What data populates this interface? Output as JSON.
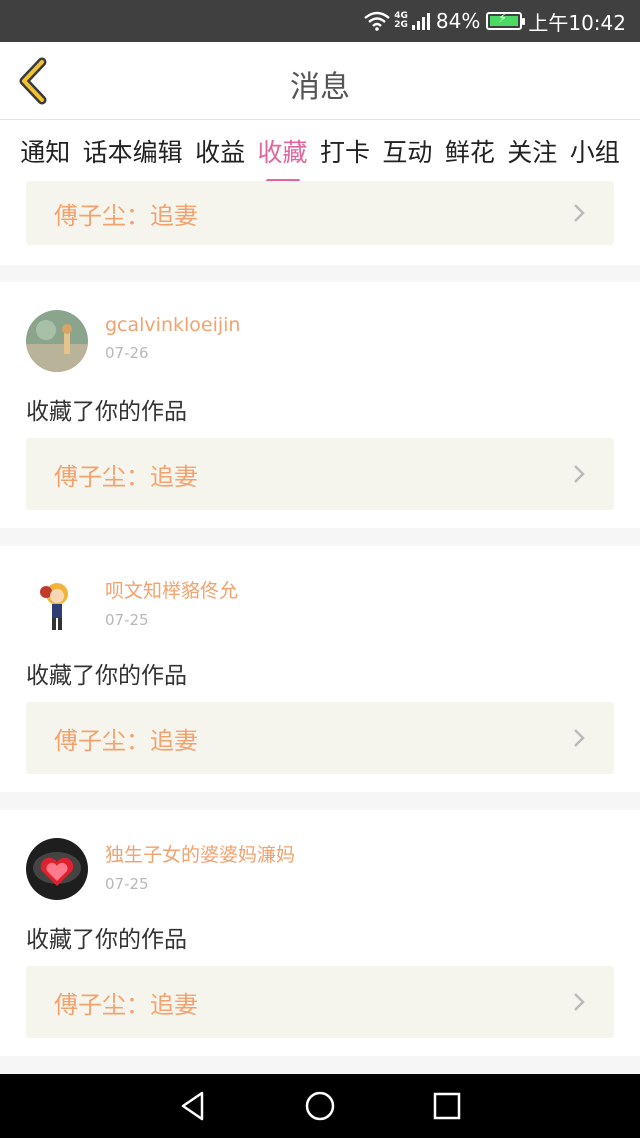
{
  "status_bar": {
    "battery": "84%",
    "time": "上午10:42",
    "network": [
      "4G",
      "2G"
    ]
  },
  "header": {
    "title": "消息"
  },
  "tabs": [
    {
      "label": "通知",
      "active": false
    },
    {
      "label": "话本编辑",
      "active": false
    },
    {
      "label": "收益",
      "active": false
    },
    {
      "label": "收藏",
      "active": true
    },
    {
      "label": "打卡",
      "active": false
    },
    {
      "label": "互动",
      "active": false
    },
    {
      "label": "鲜花",
      "active": false
    },
    {
      "label": "关注",
      "active": false
    },
    {
      "label": "小组",
      "active": false
    }
  ],
  "partial_card": {
    "work_title": "傅子尘：追妻"
  },
  "cards": [
    {
      "author": "gcalvinkloeijin",
      "date": "07-26",
      "action": "收藏了你的作品",
      "work_title": "傅子尘：追妻"
    },
    {
      "author": "呗文知榉貉佟允",
      "date": "07-25",
      "action": "收藏了你的作品",
      "work_title": "傅子尘：追妻"
    },
    {
      "author": "独生子女的婆婆妈濂妈",
      "date": "07-25",
      "action": "收藏了你的作品",
      "work_title": "傅子尘：追妻"
    }
  ],
  "colors": {
    "accent": "#e0669b",
    "name_orange": "#f3a26e",
    "status_bar": "#404040"
  }
}
